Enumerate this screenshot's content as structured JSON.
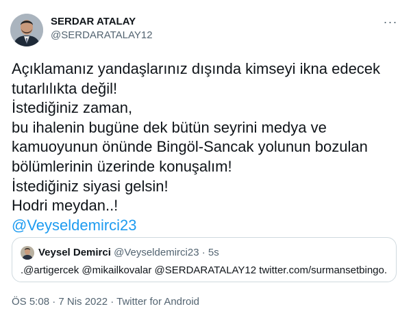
{
  "author": {
    "name": "SERDAR ATALAY",
    "handle": "@SERDARATALAY12"
  },
  "menu": {
    "icon": "more-dots-icon"
  },
  "tweet": {
    "lines": [
      "Açıklamanız yandaşlarınız dışında kimseyi ikna edecek",
      "tutarlılıkta değil!",
      "İstediğiniz zaman,",
      "bu ihalenin bugüne dek bütün seyrini medya ve",
      "kamuoyunun önünde Bingöl-Sancak yolunun bozulan",
      "bölümlerinin üzerinde konuşalım!",
      "İstediğiniz siyasi gelsin!",
      "Hodri meydan..!"
    ],
    "mention": "@Veyseldemirci23"
  },
  "quote": {
    "name": "Veysel Demirci",
    "handle": "@Veyseldemirci23",
    "separator": "·",
    "time": "5s",
    "text": ".@artigercek @mikailkovalar @SERDARATALAY12 twitter.com/surmansetbingo..."
  },
  "footer": {
    "timestamp": "ÖS 5:08 · 7 Nis 2022 · Twitter for Android"
  },
  "colors": {
    "link": "#1d9bf0",
    "muted": "#536471",
    "border": "#cfd9de"
  }
}
